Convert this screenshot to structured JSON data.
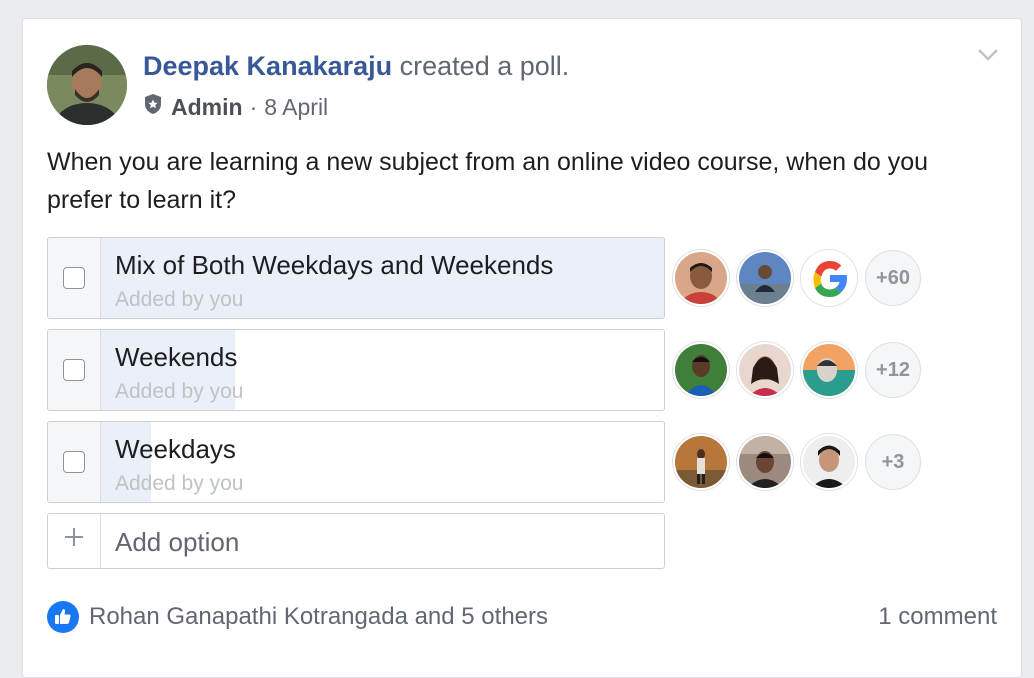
{
  "post": {
    "author": "Deepak Kanakaraju",
    "action": "created a poll.",
    "role": "Admin",
    "separator": "·",
    "date": "8 April",
    "question": "When you are learning a new subject from an online video course, when do you prefer to learn it?"
  },
  "poll": {
    "options": [
      {
        "label": "Mix of Both Weekdays and Weekends",
        "sub": "Added by you",
        "more": "+60",
        "vote_share": 1.0
      },
      {
        "label": "Weekends",
        "sub": "Added by you",
        "more": "+12",
        "vote_share": 0.24
      },
      {
        "label": "Weekdays",
        "sub": "Added by you",
        "more": "+3",
        "vote_share": 0.09
      }
    ],
    "add_option_placeholder": "Add option"
  },
  "footer": {
    "likes": "Rohan Ganapathi Kotrangada and 5 others",
    "comments": "1 comment"
  },
  "colors": {
    "link": "#385898",
    "like_blue": "#1877f2",
    "bar_fill": "#ebeff7"
  }
}
